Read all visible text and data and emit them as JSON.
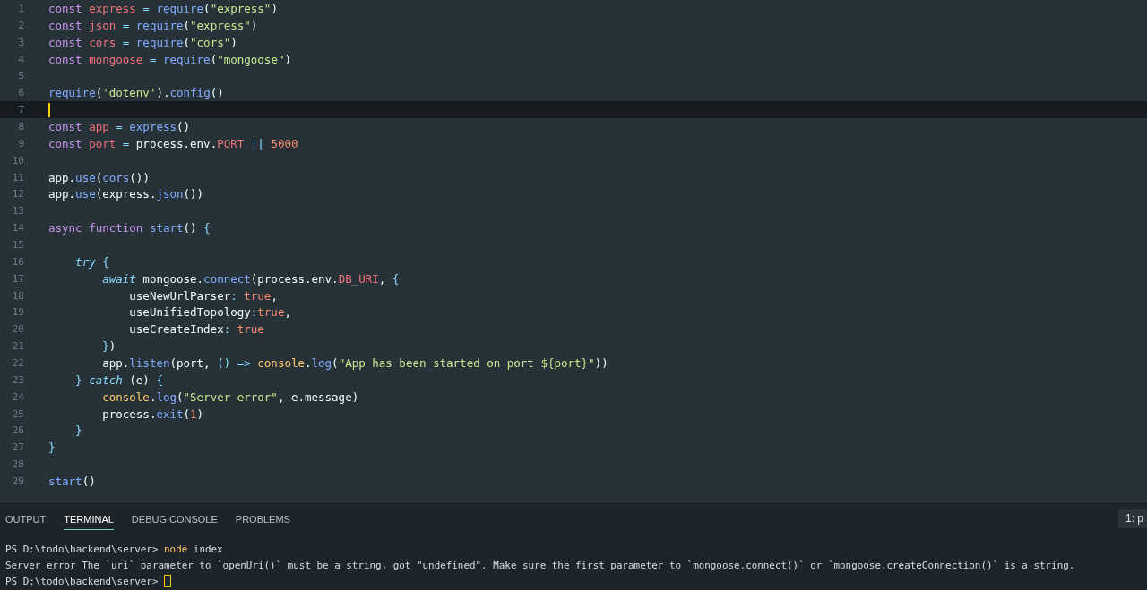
{
  "editor": {
    "lines": [
      {
        "number": "1",
        "current": false,
        "tokens": [
          {
            "text": "const ",
            "kind": "keyword"
          },
          {
            "text": "express",
            "kind": "variable"
          },
          {
            "text": " = ",
            "kind": "punct"
          },
          {
            "text": "require",
            "kind": "function"
          },
          {
            "text": "("
          },
          {
            "text": "\"express\"",
            "kind": "string"
          },
          {
            "text": ")"
          }
        ]
      },
      {
        "number": "2",
        "current": false,
        "tokens": [
          {
            "text": "const ",
            "kind": "keyword"
          },
          {
            "text": "json",
            "kind": "variable"
          },
          {
            "text": " = ",
            "kind": "punct"
          },
          {
            "text": "require",
            "kind": "function"
          },
          {
            "text": "("
          },
          {
            "text": "\"express\"",
            "kind": "string"
          },
          {
            "text": ")"
          }
        ]
      },
      {
        "number": "3",
        "current": false,
        "tokens": [
          {
            "text": "const ",
            "kind": "keyword"
          },
          {
            "text": "cors",
            "kind": "variable"
          },
          {
            "text": " = ",
            "kind": "punct"
          },
          {
            "text": "require",
            "kind": "function"
          },
          {
            "text": "("
          },
          {
            "text": "\"cors\"",
            "kind": "string"
          },
          {
            "text": ")"
          }
        ]
      },
      {
        "number": "4",
        "current": false,
        "tokens": [
          {
            "text": "const ",
            "kind": "keyword"
          },
          {
            "text": "mongoose",
            "kind": "variable"
          },
          {
            "text": " = ",
            "kind": "punct"
          },
          {
            "text": "require",
            "kind": "function"
          },
          {
            "text": "("
          },
          {
            "text": "\"mongoose\"",
            "kind": "string"
          },
          {
            "text": ")"
          }
        ]
      },
      {
        "number": "5",
        "current": false
      },
      {
        "number": "6",
        "current": false,
        "tokens": [
          {
            "text": "require",
            "kind": "function"
          },
          {
            "text": "("
          },
          {
            "text": "'dotenv'",
            "kind": "string"
          },
          {
            "text": ")."
          },
          {
            "text": "config",
            "kind": "function"
          },
          {
            "text": "()"
          }
        ]
      },
      {
        "number": "7",
        "current": true
      },
      {
        "number": "8",
        "current": false,
        "tokens": [
          {
            "text": "const ",
            "kind": "keyword"
          },
          {
            "text": "app",
            "kind": "variable"
          },
          {
            "text": " = ",
            "kind": "punct"
          },
          {
            "text": "express",
            "kind": "function"
          },
          {
            "text": "()"
          }
        ]
      },
      {
        "number": "9",
        "current": false,
        "tokens": [
          {
            "text": "const ",
            "kind": "keyword"
          },
          {
            "text": "port",
            "kind": "variable"
          },
          {
            "text": " = ",
            "kind": "punct"
          },
          {
            "text": "process.env."
          },
          {
            "text": "PORT",
            "kind": "variable"
          },
          {
            "text": " || ",
            "kind": "punct"
          },
          {
            "text": "5000",
            "kind": "constant"
          }
        ]
      },
      {
        "number": "10",
        "current": false
      },
      {
        "number": "11",
        "current": false,
        "tokens": [
          {
            "text": "app."
          },
          {
            "text": "use",
            "kind": "function"
          },
          {
            "text": "("
          },
          {
            "text": "cors",
            "kind": "function"
          },
          {
            "text": "())"
          }
        ]
      },
      {
        "number": "12",
        "current": false,
        "tokens": [
          {
            "text": "app."
          },
          {
            "text": "use",
            "kind": "function"
          },
          {
            "text": "(express."
          },
          {
            "text": "json",
            "kind": "function"
          },
          {
            "text": "())"
          }
        ]
      },
      {
        "number": "13",
        "current": false
      },
      {
        "number": "14",
        "current": false,
        "tokens": [
          {
            "text": "async function ",
            "kind": "keyword"
          },
          {
            "text": "start",
            "kind": "function"
          },
          {
            "text": "() "
          },
          {
            "text": "{",
            "kind": "punct"
          }
        ]
      },
      {
        "number": "15",
        "current": false
      },
      {
        "number": "16",
        "current": false,
        "tokens": [
          {
            "text": "    try ",
            "kind": "control"
          },
          {
            "text": "{",
            "kind": "punct"
          }
        ]
      },
      {
        "number": "17",
        "current": false,
        "tokens": [
          {
            "text": "        await",
            "kind": "control"
          },
          {
            "text": " mongoose."
          },
          {
            "text": "connect",
            "kind": "function"
          },
          {
            "text": "(process.env."
          },
          {
            "text": "DB_URI",
            "kind": "variable"
          },
          {
            "text": ", "
          },
          {
            "text": "{",
            "kind": "punct"
          }
        ]
      },
      {
        "number": "18",
        "current": false,
        "tokens": [
          {
            "text": "            useNewUrlParser"
          },
          {
            "text": ": ",
            "kind": "punct"
          },
          {
            "text": "true",
            "kind": "constant"
          },
          {
            "text": ","
          }
        ]
      },
      {
        "number": "19",
        "current": false,
        "tokens": [
          {
            "text": "            useUnifiedTopology"
          },
          {
            "text": ":",
            "kind": "punct"
          },
          {
            "text": "true",
            "kind": "constant"
          },
          {
            "text": ","
          }
        ]
      },
      {
        "number": "20",
        "current": false,
        "tokens": [
          {
            "text": "            useCreateIndex"
          },
          {
            "text": ": ",
            "kind": "punct"
          },
          {
            "text": "true",
            "kind": "constant"
          }
        ]
      },
      {
        "number": "21",
        "current": false,
        "tokens": [
          {
            "text": "        }",
            "kind": "punct"
          },
          {
            "text": ")"
          }
        ]
      },
      {
        "number": "22",
        "current": false,
        "tokens": [
          {
            "text": "        app."
          },
          {
            "text": "listen",
            "kind": "function"
          },
          {
            "text": "(port, "
          },
          {
            "text": "() => ",
            "kind": "punct"
          },
          {
            "text": "console",
            "kind": "class"
          },
          {
            "text": "."
          },
          {
            "text": "log",
            "kind": "function"
          },
          {
            "text": "("
          },
          {
            "text": "\"App has been started on port ${port}\"",
            "kind": "string"
          },
          {
            "text": "))"
          }
        ]
      },
      {
        "number": "23",
        "current": false,
        "tokens": [
          {
            "text": "    } ",
            "kind": "punct"
          },
          {
            "text": "catch",
            "kind": "control"
          },
          {
            "text": " (e) "
          },
          {
            "text": "{",
            "kind": "punct"
          }
        ]
      },
      {
        "number": "24",
        "current": false,
        "tokens": [
          {
            "text": "        console",
            "kind": "class"
          },
          {
            "text": "."
          },
          {
            "text": "log",
            "kind": "function"
          },
          {
            "text": "("
          },
          {
            "text": "\"Server error\"",
            "kind": "string"
          },
          {
            "text": ", e.message)"
          }
        ]
      },
      {
        "number": "25",
        "current": false,
        "tokens": [
          {
            "text": "        process."
          },
          {
            "text": "exit",
            "kind": "function"
          },
          {
            "text": "("
          },
          {
            "text": "1",
            "kind": "constant"
          },
          {
            "text": ")"
          }
        ]
      },
      {
        "number": "26",
        "current": false,
        "tokens": [
          {
            "text": "    }",
            "kind": "punct"
          }
        ]
      },
      {
        "number": "27",
        "current": false,
        "tokens": [
          {
            "text": "}",
            "kind": "punct"
          }
        ]
      },
      {
        "number": "28",
        "current": false
      },
      {
        "number": "29",
        "current": false,
        "tokens": [
          {
            "text": "start",
            "kind": "function"
          },
          {
            "text": "()"
          }
        ]
      }
    ]
  },
  "panel": {
    "tabs": [
      {
        "label": "OUTPUT",
        "selected": false
      },
      {
        "label": "TERMINAL",
        "selected": true
      },
      {
        "label": "DEBUG CONSOLE",
        "selected": false
      },
      {
        "label": "PROBLEMS",
        "selected": false
      }
    ],
    "terminal_select": "1: p",
    "terminal_lines": [
      {
        "tokens": [
          {
            "text": "PS D:\\todo\\backend\\server> "
          },
          {
            "text": "node",
            "kind": "command"
          },
          {
            "text": " index"
          }
        ],
        "cursor": false
      },
      {
        "tokens": [
          {
            "text": "Server error The `uri` parameter to `openUri()` must be a string, got \"undefined\". Make sure the first parameter to `mongoose.connect()` or `mongoose.createConnection()` is a string."
          }
        ],
        "cursor": false
      },
      {
        "tokens": [
          {
            "text": "PS D:\\todo\\backend\\server> "
          }
        ],
        "cursor": true
      }
    ]
  }
}
